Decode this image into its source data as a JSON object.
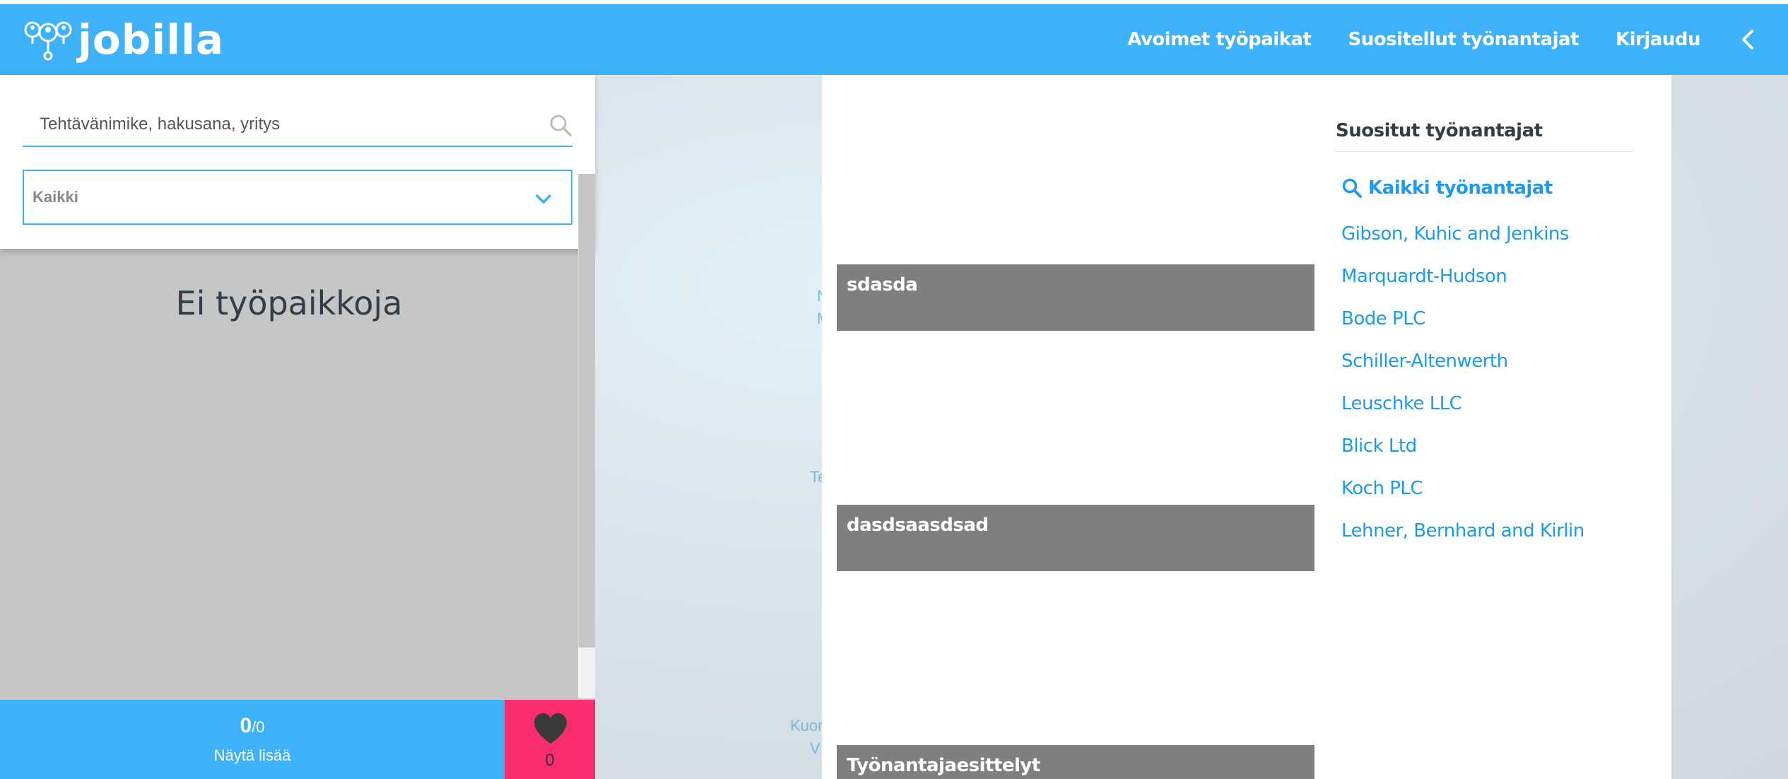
{
  "header": {
    "logo_text": "jobilla",
    "nav": [
      {
        "label": "Avoimet työpaikat"
      },
      {
        "label": "Suositellut työnantajat"
      },
      {
        "label": "Kirjaudu"
      }
    ]
  },
  "sidebar": {
    "search_placeholder": "Tehtävänimike, hakusana, yritys",
    "select_value": "Kaikki",
    "empty_message": "Ei työpaikkoja",
    "shown_count": "0",
    "total_count": "/0",
    "show_more_label": "Näytä lisää",
    "favorites_count": "0"
  },
  "background_fragments": [
    "N",
    "M",
    "Te",
    "Kuor",
    "V"
  ],
  "content": {
    "banners": [
      {
        "label": "sdasda"
      },
      {
        "label": "dasdsaasdsad"
      },
      {
        "label": "Työnantajaesittelyt"
      }
    ]
  },
  "employers": {
    "title": "Suositut työnantajat",
    "all_label": "Kaikki työnantajat",
    "items": [
      {
        "label": "Gibson, Kuhic and Jenkins"
      },
      {
        "label": "Marquardt-Hudson"
      },
      {
        "label": "Bode PLC"
      },
      {
        "label": "Schiller-Altenwerth"
      },
      {
        "label": "Leuschke LLC"
      },
      {
        "label": "Blick Ltd"
      },
      {
        "label": "Koch PLC"
      },
      {
        "label": "Lehner, Bernhard and Kirlin"
      }
    ]
  },
  "colors": {
    "brand": "#3db1f9",
    "favorites": "#fb2d6e",
    "link": "#1c9aee",
    "banner": "#7f7f7f"
  }
}
